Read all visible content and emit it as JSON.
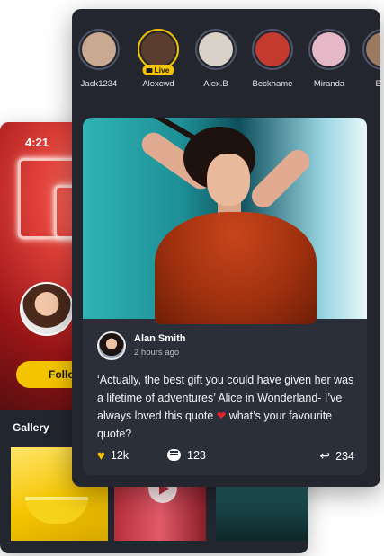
{
  "back_screen": {
    "status_time": "4:21",
    "follow_label": "Follo",
    "gallery_title": "Gallery"
  },
  "stories": [
    {
      "name": "Jack1234",
      "live": false,
      "color": "#c9a98f"
    },
    {
      "name": "Alexcwd",
      "live": true,
      "live_label": "Live",
      "color": "#5a3d2e"
    },
    {
      "name": "Alex.B",
      "live": false,
      "color": "#d8d2c8"
    },
    {
      "name": "Beckhame",
      "live": false,
      "color": "#c43a2f"
    },
    {
      "name": "Miranda",
      "live": false,
      "color": "#e6b7c6"
    },
    {
      "name": "Bob",
      "live": false,
      "color": "#9a7a60"
    }
  ],
  "post": {
    "author": "Alan Smith",
    "time": "2 hours ago",
    "text": "‘Actually, the best gift you could have given her was a lifetime of adventures’ Alice in Wonderland- I’ve always loved this quote",
    "text_tail": "what’s your favourite quote?",
    "likes": "12k",
    "comments": "123",
    "shares": "234"
  },
  "colors": {
    "accent": "#f5c400",
    "background": "#23262e",
    "card": "#2b2f39"
  }
}
